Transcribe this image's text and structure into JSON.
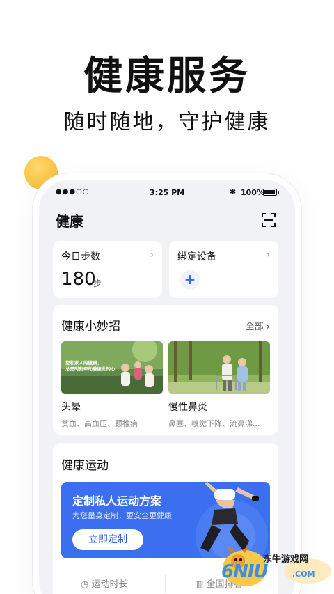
{
  "hero": {
    "title": "健康服务",
    "subtitle": "随时随地，守护健康"
  },
  "status_bar": {
    "signal": "●●●○○",
    "time": "3:25 PM",
    "battery": "100%"
  },
  "app": {
    "title": "健康"
  },
  "steps_card": {
    "label": "今日步数",
    "value": "180",
    "unit": "步"
  },
  "device_card": {
    "label": "绑定设备",
    "add": "+"
  },
  "tips": {
    "title": "健康小妙招",
    "see_all": "全部",
    "items": [
      {
        "name": "头晕",
        "desc": "贫血、高血压、颈椎病",
        "image_text_1": "您和家人的健康，",
        "image_text_2": "总是时刻牵动着彼此的心"
      },
      {
        "name": "慢性鼻炎",
        "desc": "鼻塞、嗅觉下降、流鼻涕..."
      }
    ]
  },
  "exercise": {
    "title": "健康运动",
    "banner_title": "定制私人运动方案",
    "banner_subtitle": "为您量身定制，更安全更健康",
    "banner_button": "立即定制",
    "tabs": [
      {
        "label": "运动时长",
        "icon": "clock-icon"
      },
      {
        "label": "全国排名",
        "icon": "bar-chart-icon"
      }
    ]
  },
  "watermark": {
    "brand": "东牛游戏网",
    "logo": "6NIU",
    "domain": ".COM"
  },
  "colors": {
    "accent": "#3b6ff0",
    "yellow": "#f5b62f",
    "background": "#f1f2f6"
  }
}
